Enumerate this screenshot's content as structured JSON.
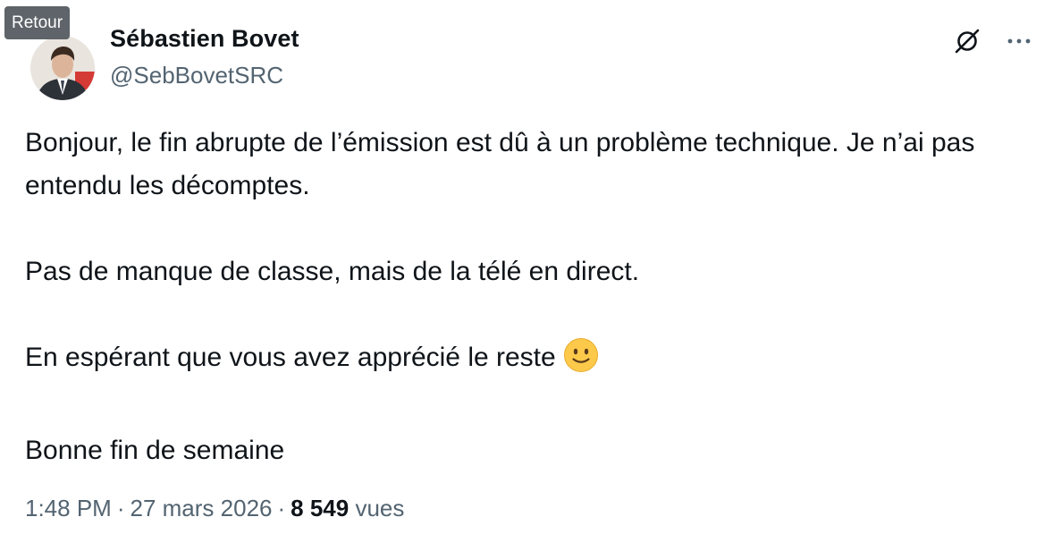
{
  "back_tooltip": "Retour",
  "author": {
    "name": "Sébastien Bovet",
    "handle": "@SebBovetSRC"
  },
  "actions": {
    "grok_icon": "grok-icon",
    "more_icon": "more-horizontal-icon"
  },
  "tweet": {
    "paragraphs": [
      "Bonjour, le fin abrupte de l’émission est dû à un problème technique. Je n’ai pas entendu les décomptes.",
      "Pas de manque de classe, mais de la télé en direct.",
      "En espérant que vous avez apprécié le reste",
      "Bonne fin de semaine"
    ],
    "emoji": "slightly-smiling-face-emoji"
  },
  "meta": {
    "time": "1:48 PM",
    "separator": "·",
    "date": "27 mars 2026",
    "views_count": "8 549",
    "views_label": "vues"
  },
  "colors": {
    "text": "#0f1419",
    "secondary": "#536471",
    "tooltip_bg": "#5e6469"
  }
}
